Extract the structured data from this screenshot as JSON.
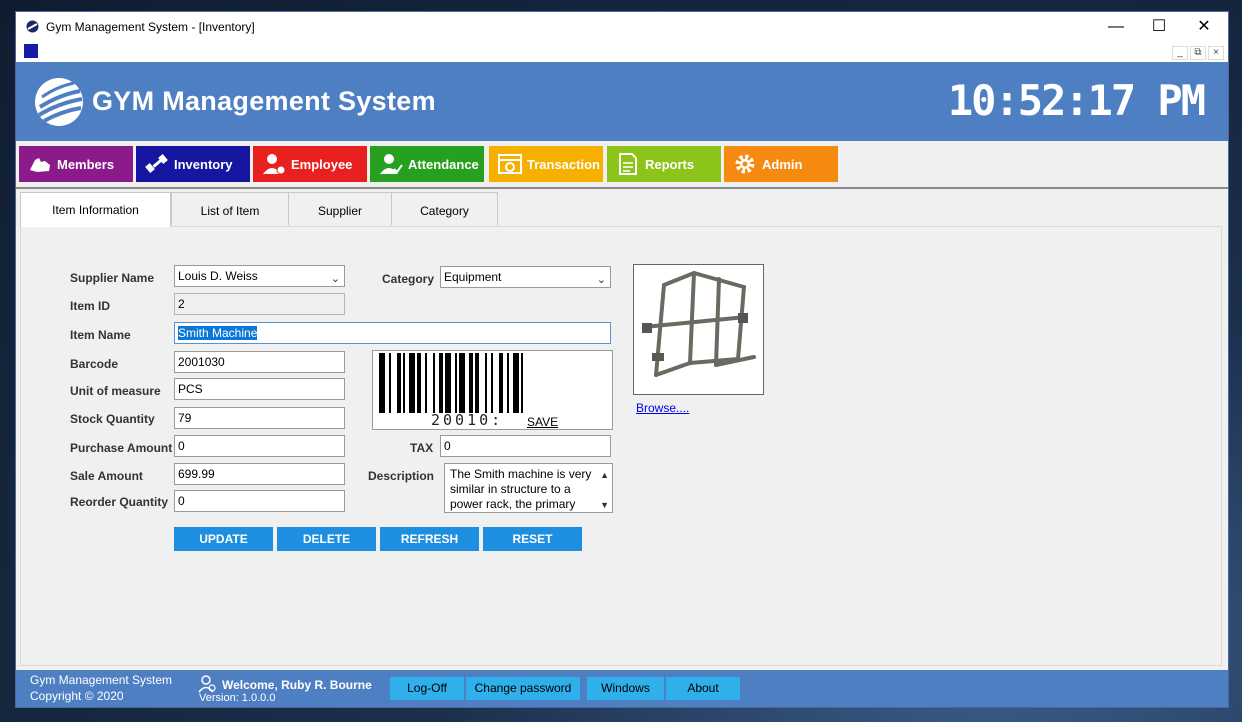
{
  "window": {
    "title": "Gym Management System - [Inventory]"
  },
  "header": {
    "app_title": "GYM Management System",
    "clock": "10:52:17 PM"
  },
  "nav": [
    {
      "label": "Members",
      "color": "#8b1a8b"
    },
    {
      "label": "Inventory",
      "color": "#1616a0"
    },
    {
      "label": "Employee",
      "color": "#e8201f"
    },
    {
      "label": "Attendance",
      "color": "#27a020"
    },
    {
      "label": "Transaction",
      "color": "#f5b000"
    },
    {
      "label": "Reports",
      "color": "#8cc41a"
    },
    {
      "label": "Admin",
      "color": "#f68a10"
    }
  ],
  "tabs": [
    "Item Information",
    "List of Item",
    "Supplier",
    "Category"
  ],
  "form": {
    "supplier_name": {
      "label": "Supplier Name",
      "value": "Louis D. Weiss"
    },
    "item_id": {
      "label": "Item ID",
      "value": "2"
    },
    "item_name": {
      "label": "Item Name",
      "value": "Smith Machine"
    },
    "barcode": {
      "label": "Barcode",
      "value": "2001030"
    },
    "unit": {
      "label": "Unit of measure",
      "value": "PCS"
    },
    "stock": {
      "label": "Stock Quantity",
      "value": "79"
    },
    "purchase": {
      "label": "Purchase Amount",
      "value": "0"
    },
    "sale": {
      "label": "Sale Amount",
      "value": "699.99"
    },
    "reorder": {
      "label": "Reorder Quantity",
      "value": "0"
    },
    "category": {
      "label": "Category",
      "value": "Equipment"
    },
    "tax": {
      "label": "TAX",
      "value": "0"
    },
    "description": {
      "label": "Description",
      "value": "The Smith machine is very similar in structure to a power rack, the primary"
    },
    "barcode_image": {
      "digits": "20010:",
      "save_label": "SAVE BARCODE"
    },
    "browse_label": "Browse...."
  },
  "actions": {
    "update": "UPDATE",
    "delete": "DELETE",
    "refresh": "REFRESH",
    "reset": "RESET"
  },
  "status": {
    "app": "Gym Management System",
    "copyright": "Copyright  © 2020",
    "welcome": "Welcome, Ruby R. Bourne",
    "version": "Version: 1.0.0.0",
    "buttons": [
      "Log-Off",
      "Change password",
      "Windows",
      "About"
    ]
  }
}
